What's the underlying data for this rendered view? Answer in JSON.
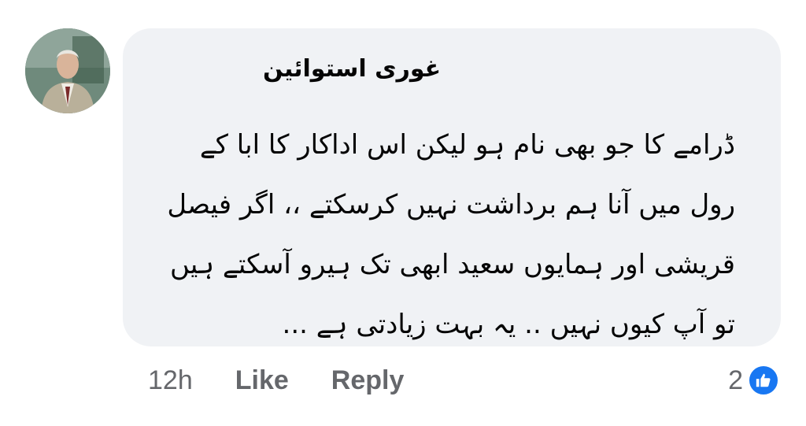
{
  "comment": {
    "author": "غوری استوائین",
    "lines": [
      "ڈرامے کا جو بھی نام ہو لیکن اس اداکار کا ابا کے",
      "رول میں آنا ہم برداشت نہیں کرسکتے ،، اگر فیصل",
      "قریشی اور ہمایوں سعید ابھی تک ہیرو آسکتے ہیں",
      "تو آپ کیوں نہیں .. یہ بہت زیادتی ہے ..."
    ],
    "time": "12h",
    "like_label": "Like",
    "reply_label": "Reply",
    "reaction_count": "2",
    "reaction_icon": "thumbs-up-icon"
  },
  "colors": {
    "bubble_bg": "#f0f2f5",
    "meta_text": "#65676b",
    "like_blue": "#1877f2"
  }
}
